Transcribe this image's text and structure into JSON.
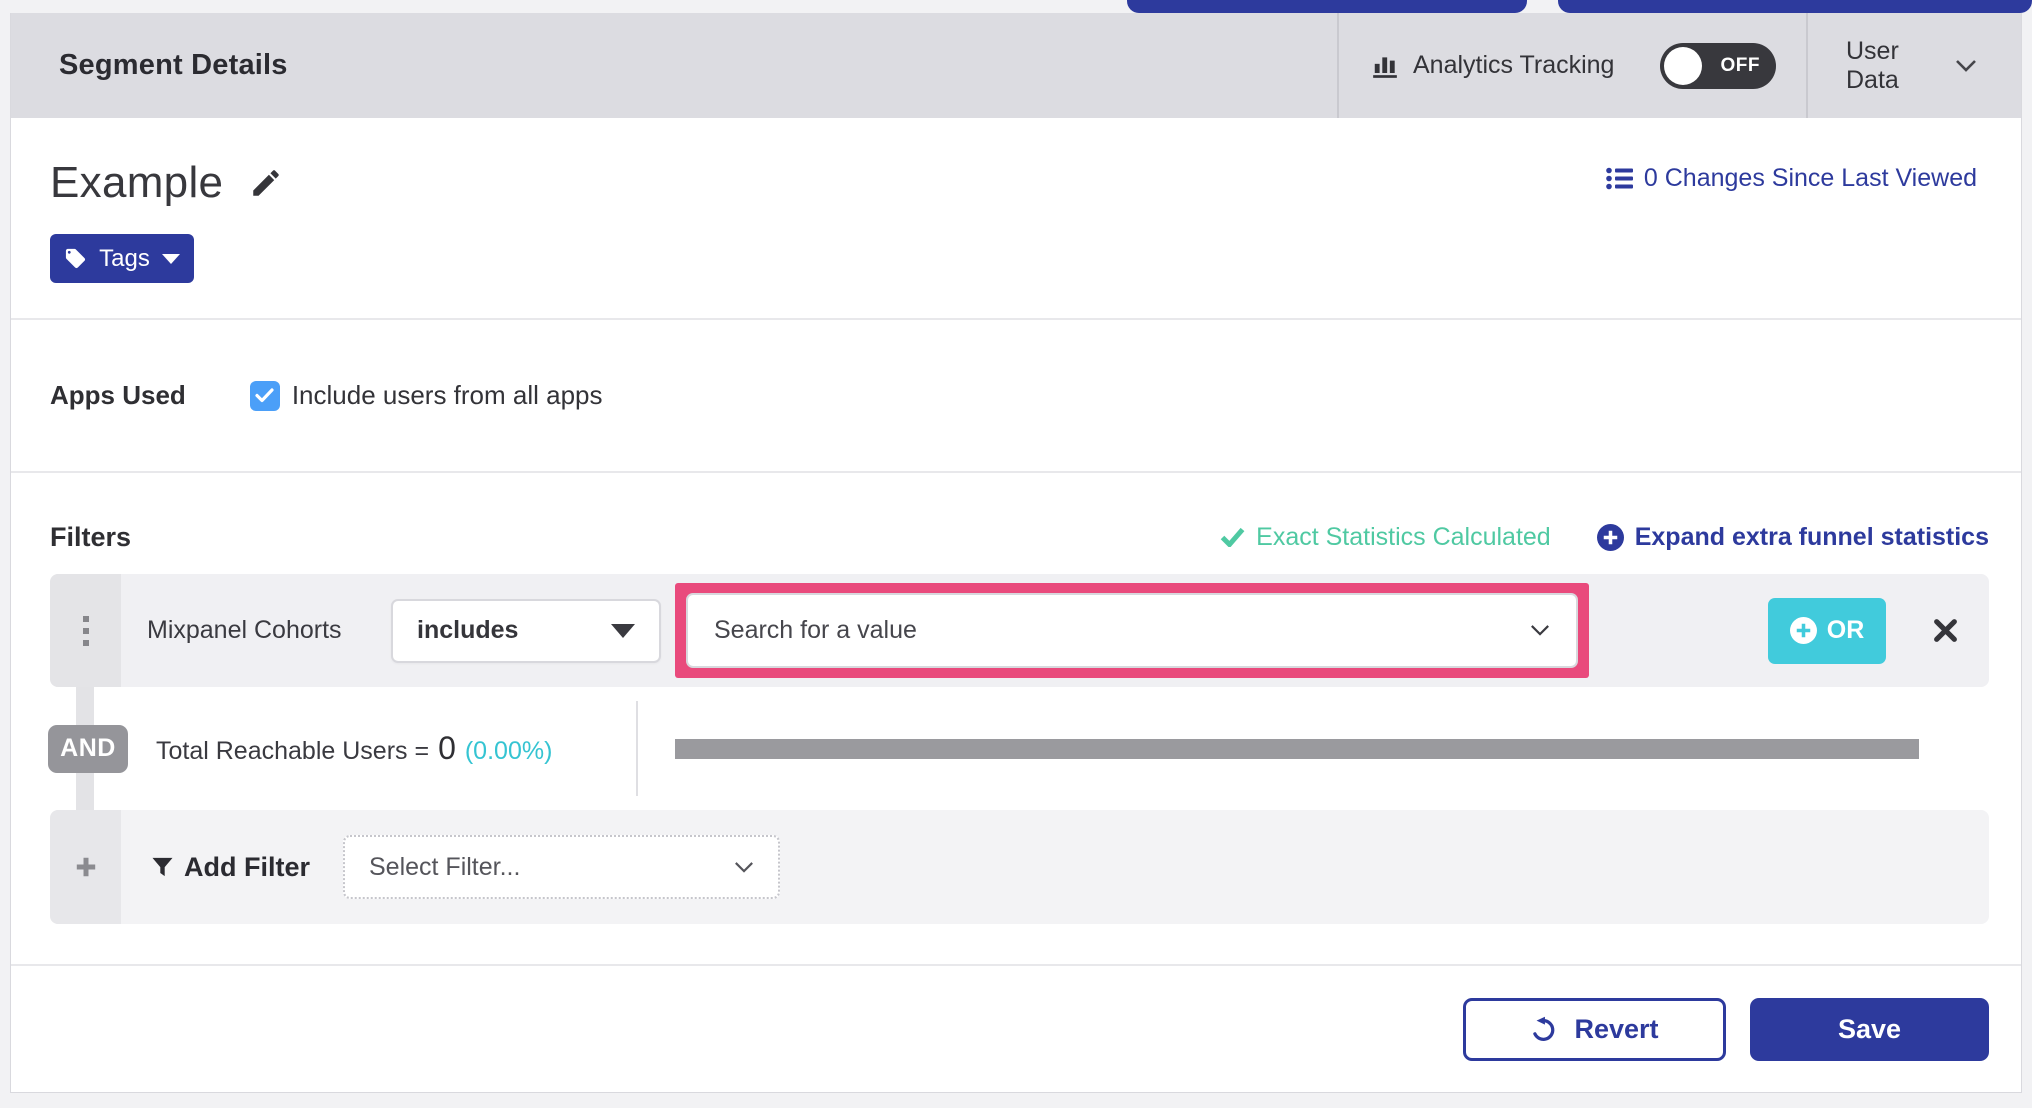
{
  "colors": {
    "indigo": "#2d3a9d",
    "teal": "#41cbdc",
    "mint_green": "#4fc9a2",
    "highlight_pink": "#e94a7c",
    "checkbox_blue": "#4b9ff8",
    "header_bg": "#dcdce1",
    "and_badge_gray": "#95959a",
    "progress_gray": "#9a9a9e"
  },
  "header": {
    "title": "Segment Details",
    "analytics_label": "Analytics Tracking",
    "toggle_state": "OFF",
    "user_data_label": "User Data"
  },
  "title_bar": {
    "segment_name": "Example",
    "changes_link": "0 Changes Since Last Viewed",
    "tags_label": "Tags"
  },
  "apps": {
    "label": "Apps Used",
    "checkbox_label": "Include users from all apps",
    "checked": true
  },
  "filters": {
    "heading": "Filters",
    "exact_stats": "Exact Statistics Calculated",
    "expand_link": "Expand extra funnel statistics",
    "row": {
      "name": "Mixpanel Cohorts",
      "operator": "includes",
      "value_placeholder": "Search for a value",
      "or_label": "OR"
    },
    "and_label": "AND",
    "reachable": {
      "label": "Total Reachable Users =",
      "count": "0",
      "percent": "(0.00%)"
    },
    "add": {
      "label": "Add Filter",
      "select_placeholder": "Select Filter..."
    }
  },
  "footer": {
    "revert_label": "Revert",
    "save_label": "Save"
  }
}
